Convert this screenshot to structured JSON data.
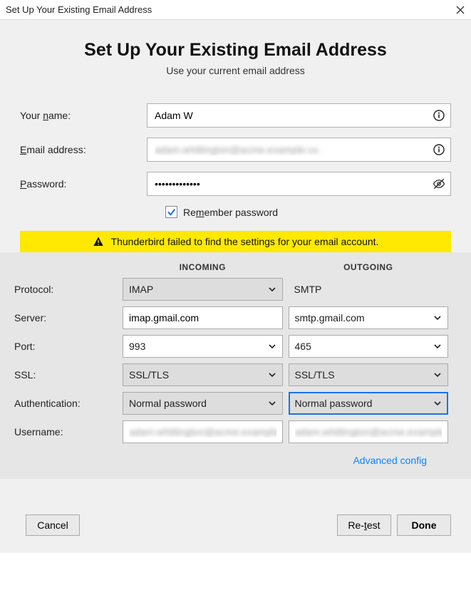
{
  "window": {
    "title": "Set Up Your Existing Email Address"
  },
  "hero": {
    "title": "Set Up Your Existing Email Address",
    "subtitle": "Use your current email address"
  },
  "form": {
    "name_label_pre": "Your ",
    "name_label_u": "n",
    "name_label_post": "ame:",
    "name_value": "Adam W",
    "email_label_u": "E",
    "email_label_post": "mail address:",
    "email_value": "adam.whittington@acme.example.co",
    "password_label_u": "P",
    "password_label_post": "assword:",
    "password_value": "•••••••••••••",
    "remember_pre": "Re",
    "remember_u": "m",
    "remember_post": "ember password",
    "remember_checked": true
  },
  "warning": "Thunderbird failed to find the settings for your email account.",
  "server": {
    "incoming_header": "INCOMING",
    "outgoing_header": "OUTGOING",
    "labels": {
      "protocol": "Protocol:",
      "server": "Server:",
      "port": "Port:",
      "ssl": "SSL:",
      "auth": "Authentication:",
      "username": "Username:"
    },
    "incoming": {
      "protocol": "IMAP",
      "server": "imap.gmail.com",
      "port": "993",
      "ssl": "SSL/TLS",
      "auth": "Normal password",
      "username": "adam.whittington@acme.example.co"
    },
    "outgoing": {
      "protocol": "SMTP",
      "server": "smtp.gmail.com",
      "port": "465",
      "ssl": "SSL/TLS",
      "auth": "Normal password",
      "username": "adam.whittington@acme.example.co"
    }
  },
  "advanced_link": "Advanced config",
  "buttons": {
    "cancel": "Cancel",
    "retest_pre": "Re-",
    "retest_u": "t",
    "retest_post": "est",
    "done": "Done"
  }
}
